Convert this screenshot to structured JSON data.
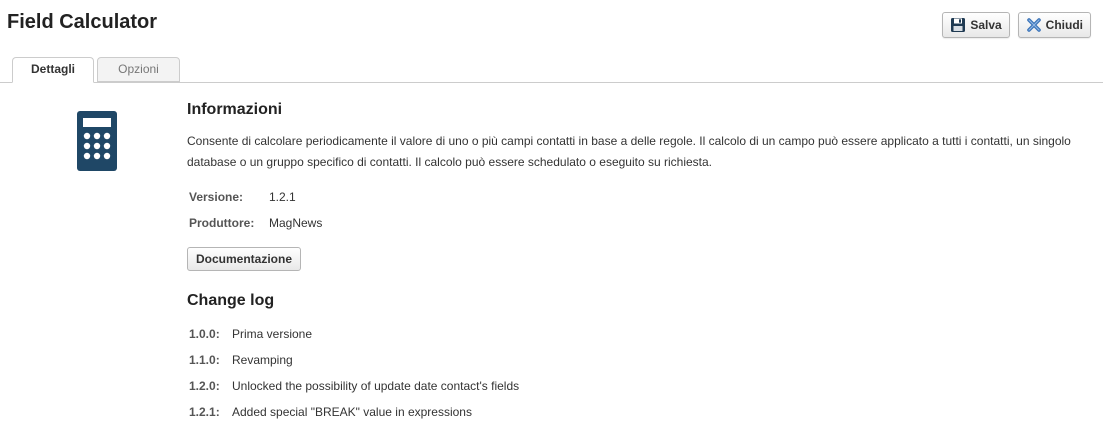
{
  "page": {
    "title": "Field Calculator"
  },
  "toolbar": {
    "save_label": "Salva",
    "close_label": "Chiudi"
  },
  "tabs": [
    {
      "label": "Dettagli",
      "active": true
    },
    {
      "label": "Opzioni",
      "active": false
    }
  ],
  "info": {
    "title": "Informazioni",
    "description": "Consente di calcolare periodicamente il valore di uno o più campi contatti in base a delle regole. Il calcolo di un campo può essere applicato a tutti i contatti, un singolo database o un gruppo specifico di contatti. Il calcolo può essere schedulato o eseguito su richiesta.",
    "version_label": "Versione:",
    "version_value": "1.2.1",
    "producer_label": "Produttore:",
    "producer_value": "MagNews",
    "doc_button": "Documentazione"
  },
  "changelog": {
    "title": "Change log",
    "items": [
      {
        "version": "1.0.0:",
        "text": "Prima versione"
      },
      {
        "version": "1.1.0:",
        "text": "Revamping"
      },
      {
        "version": "1.2.0:",
        "text": "Unlocked the possibility of update date contact's fields"
      },
      {
        "version": "1.2.1:",
        "text": "Added special \"BREAK\" value in expressions"
      }
    ]
  },
  "icons": {
    "app": "calculator-icon",
    "save": "floppy-disk-icon",
    "close": "close-x-icon"
  },
  "colors": {
    "calculator": "#1f4766",
    "close_icon": "#3a73b8"
  }
}
